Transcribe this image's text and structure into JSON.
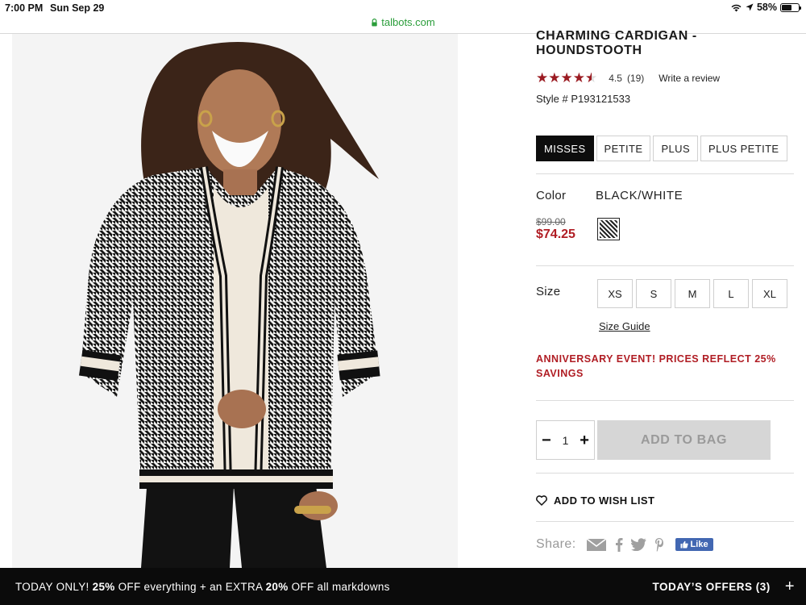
{
  "status_bar": {
    "time": "7:00 PM",
    "date": "Sun Sep 29",
    "battery": "58%"
  },
  "browser": {
    "url": "talbots.com"
  },
  "product": {
    "title": "CHARMING CARDIGAN - HOUNDSTOOTH",
    "rating": {
      "stars": 4.5,
      "value": "4.5",
      "count": "(19)",
      "write_review": "Write a review"
    },
    "style_number": "Style # P193121533",
    "fit_tabs": [
      {
        "label": "MISSES",
        "active": true
      },
      {
        "label": "PETITE",
        "active": false
      },
      {
        "label": "PLUS",
        "active": false
      },
      {
        "label": "PLUS PETITE",
        "active": false
      }
    ],
    "color_label": "Color",
    "color_name": "BLACK/WHITE",
    "was_price": "$99.00",
    "now_price": "$74.25",
    "size_label": "Size",
    "sizes": [
      "XS",
      "S",
      "M",
      "L",
      "XL"
    ],
    "size_guide": "Size Guide",
    "promo": "ANNIVERSARY EVENT! PRICES REFLECT 25% SAVINGS",
    "quantity": "1",
    "add_to_bag": "ADD TO BAG",
    "wishlist": "ADD TO WISH LIST",
    "share_label": "Share:",
    "fb_like": "Like"
  },
  "banner": {
    "prefix": "TODAY ONLY! ",
    "pct1": "25%",
    "mid": " OFF everything + an EXTRA ",
    "pct2": "20%",
    "suffix": " OFF all markdowns",
    "offers": "TODAY’S OFFERS (3)",
    "plus": "+"
  },
  "colors": {
    "accent_red": "#b01d24",
    "star_red": "#9b1b22",
    "banner_bg": "#0b0b0b",
    "url_green": "#2a9d3a"
  }
}
